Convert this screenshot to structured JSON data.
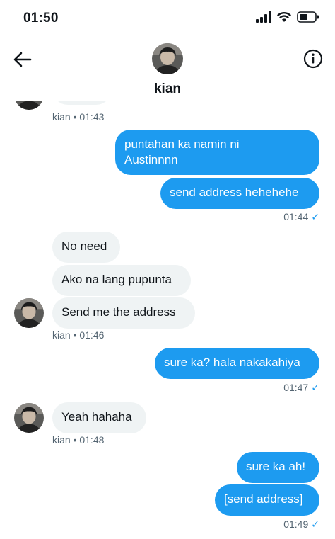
{
  "status_bar": {
    "time": "01:50"
  },
  "header": {
    "name": "kian"
  },
  "meta_dot": "•",
  "messages": {
    "m0": {
      "meta": "kian • 01:43"
    },
    "m1": {
      "text1": "puntahan ka namin ni",
      "text2": "Austinnnn"
    },
    "m2": {
      "text": "send address hehehehe",
      "meta": "01:44"
    },
    "m3": {
      "text": "No need"
    },
    "m4": {
      "text": "Ako na lang pupunta"
    },
    "m5": {
      "text": "Send me the address",
      "meta": "kian • 01:46"
    },
    "m6": {
      "text": "sure ka? hala nakakahiya",
      "meta": "01:47"
    },
    "m7": {
      "text": "Yeah hahaha",
      "meta": "kian • 01:48"
    },
    "m8": {
      "text": "sure ka ah!"
    },
    "m9": {
      "text": "[send address]",
      "meta": "01:49"
    }
  },
  "colors": {
    "accent": "#1d9bf0",
    "incoming_bubble": "#eff3f4",
    "meta_text": "#536471"
  },
  "icons": [
    "back-arrow-icon",
    "info-icon",
    "cellular-signal-icon",
    "wifi-icon",
    "battery-icon",
    "read-check-icon"
  ]
}
